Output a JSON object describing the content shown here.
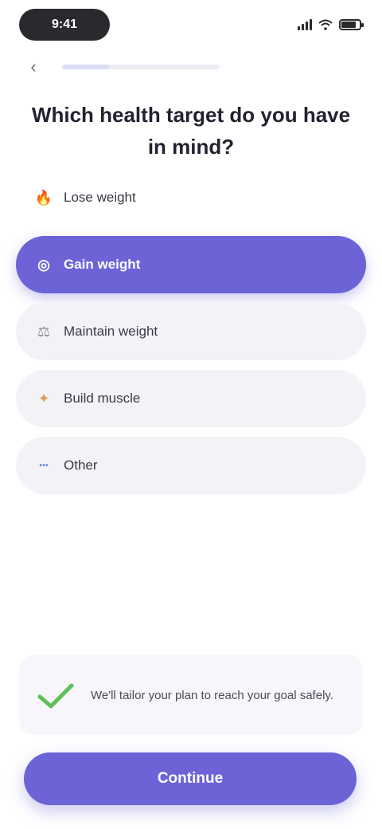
{
  "status_bar": {
    "time": "9:41"
  },
  "nav": {
    "back_icon": "chevron-left-icon",
    "progress_fraction": 0.3
  },
  "title": "Which health target do you have in mind?",
  "options": [
    {
      "label": "Lose weight",
      "icon": "flame-icon",
      "icon_color": "#e0564f",
      "selected": false,
      "style": "plain"
    },
    {
      "label": "Gain weight",
      "icon": "target-icon",
      "icon_color": "#ffffff",
      "selected": true,
      "style": "selected"
    },
    {
      "label": "Maintain weight",
      "icon": "scale-icon",
      "icon_color": "#8b8b9a",
      "selected": false,
      "style": "normal"
    },
    {
      "label": "Build muscle",
      "icon": "muscle-icon",
      "icon_color": "#e0a05a",
      "selected": false,
      "style": "normal"
    },
    {
      "label": "Other",
      "icon": "dots-icon",
      "icon_color": "#6a8fd8",
      "selected": false,
      "style": "normal"
    }
  ],
  "tip": {
    "icon": "checkmark-icon",
    "text": "We'll tailor your plan to reach your goal safely."
  },
  "continue_button": {
    "label": "Continue"
  },
  "colors": {
    "accent": "#6b63d6",
    "option_bg": "#f3f3f7",
    "check_green": "#5fbf5a"
  }
}
